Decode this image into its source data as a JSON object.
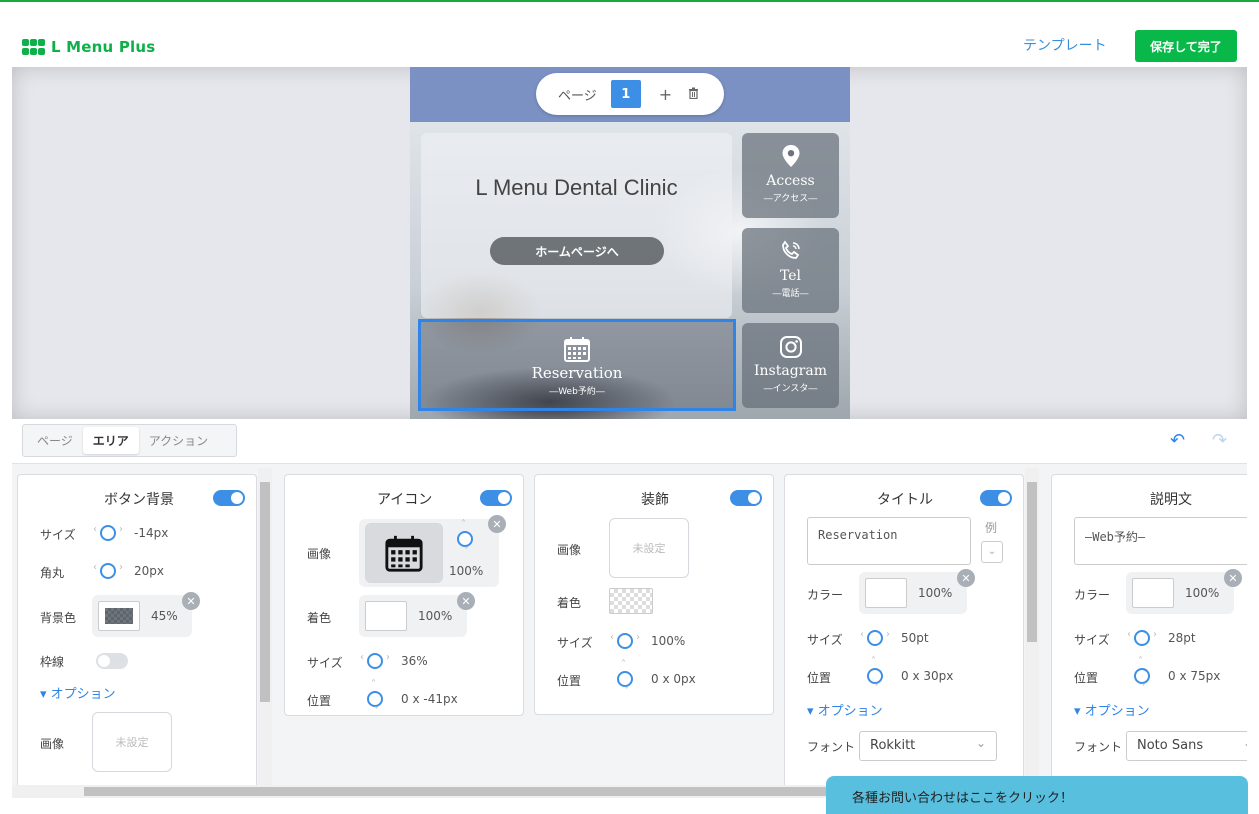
{
  "header": {
    "logo_text": "L Menu Plus",
    "template_link": "テンプレート",
    "save_button": "保存して完了"
  },
  "preview": {
    "page_label": "ページ",
    "page_number": "1",
    "add_icon": "plus-icon",
    "delete_icon": "trash-icon",
    "clinic_title": "L Menu Dental Clinic",
    "home_button": "ホームページへ",
    "buttons": [
      {
        "title": "Access",
        "sub": "―アクセス―",
        "icon": "map-pin-icon"
      },
      {
        "title": "Tel",
        "sub": "―電話―",
        "icon": "phone-icon"
      },
      {
        "title": "Instagram",
        "sub": "―インスタ―",
        "icon": "instagram-icon"
      }
    ],
    "reservation": {
      "title": "Reservation",
      "sub": "―Web予約―",
      "icon": "calendar-icon"
    }
  },
  "tabs": [
    "ページ",
    "エリア",
    "アクション"
  ],
  "active_tab": "エリア",
  "panels": {
    "button_bg": {
      "title": "ボタン背景",
      "size_label": "サイズ",
      "size_value": "-14px",
      "radius_label": "角丸",
      "radius_value": "20px",
      "bg_label": "背景色",
      "bg_value": "45%",
      "border_label": "枠線",
      "options_label": "オプション",
      "image_label": "画像",
      "image_unset": "未設定"
    },
    "icon": {
      "title": "アイコン",
      "image_label": "画像",
      "image_value": "100%",
      "color_label": "着色",
      "color_value": "100%",
      "size_label": "サイズ",
      "size_value": "36%",
      "pos_label": "位置",
      "pos_value": "0 x -41px"
    },
    "decoration": {
      "title": "装飾",
      "image_label": "画像",
      "image_unset": "未設定",
      "color_label": "着色",
      "size_label": "サイズ",
      "size_value": "100%",
      "pos_label": "位置",
      "pos_value": "0 x 0px"
    },
    "title": {
      "title": "タイトル",
      "text": "Reservation",
      "example": "例",
      "color_label": "カラー",
      "color_value": "100%",
      "size_label": "サイズ",
      "size_value": "50pt",
      "pos_label": "位置",
      "pos_value": "0 x 30px",
      "options_label": "オプション",
      "font_label": "フォント",
      "font_value": "Rokkitt"
    },
    "description": {
      "title": "説明文",
      "text": "―Web予約―",
      "color_label": "カラー",
      "color_value": "100%",
      "size_label": "サイズ",
      "size_value": "28pt",
      "pos_label": "位置",
      "pos_value": "0 x 75px",
      "options_label": "オプション",
      "font_label": "フォント",
      "font_value": "Noto Sans"
    }
  },
  "contact_banner": "各種お問い合わせはここをクリック！",
  "colors": {
    "brand": "#0eb04a",
    "accent": "#3d8fe6",
    "save": "#08b94a",
    "banner": "#58bfdf"
  }
}
